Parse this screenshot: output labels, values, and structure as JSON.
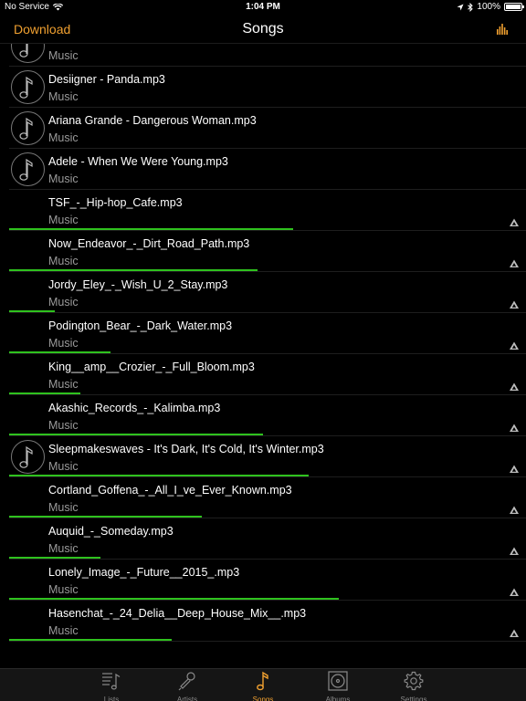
{
  "status": {
    "carrier": "No Service",
    "time": "1:04 PM",
    "battery": "100%"
  },
  "nav": {
    "back_label": "Download",
    "title": "Songs"
  },
  "colors": {
    "accent": "#f0a030",
    "progress": "#2fc21e"
  },
  "songs": [
    {
      "title": "",
      "subtitle": "Music",
      "art": true,
      "cloud": false,
      "progress": 0
    },
    {
      "title": "Desiigner - Panda.mp3",
      "subtitle": "Music",
      "art": true,
      "cloud": false,
      "progress": 0
    },
    {
      "title": "Ariana Grande - Dangerous Woman.mp3",
      "subtitle": "Music",
      "art": true,
      "cloud": false,
      "progress": 0
    },
    {
      "title": "Adele - When We Were Young.mp3",
      "subtitle": "Music",
      "art": true,
      "cloud": false,
      "progress": 0
    },
    {
      "title": "TSF_-_Hip-hop_Cafe.mp3",
      "subtitle": "Music",
      "art": false,
      "cloud": true,
      "progress": 0.56
    },
    {
      "title": "Now_Endeavor_-_Dirt_Road_Path.mp3",
      "subtitle": "Music",
      "art": false,
      "cloud": true,
      "progress": 0.49
    },
    {
      "title": "Jordy_Eley_-_Wish_U_2_Stay.mp3",
      "subtitle": "Music",
      "art": false,
      "cloud": true,
      "progress": 0.09
    },
    {
      "title": "Podington_Bear_-_Dark_Water.mp3",
      "subtitle": "Music",
      "art": false,
      "cloud": true,
      "progress": 0.2
    },
    {
      "title": "King__amp__Crozier_-_Full_Bloom.mp3",
      "subtitle": "Music",
      "art": false,
      "cloud": true,
      "progress": 0.14
    },
    {
      "title": "Akashic_Records_-_Kalimba.mp3",
      "subtitle": "Music",
      "art": false,
      "cloud": true,
      "progress": 0.5
    },
    {
      "title": "Sleepmakeswaves - It's Dark, It's Cold, It's Winter.mp3",
      "subtitle": "Music",
      "art": true,
      "cloud": true,
      "progress": 0.59
    },
    {
      "title": "Cortland_Goffena_-_All_I_ve_Ever_Known.mp3",
      "subtitle": "Music",
      "art": false,
      "cloud": true,
      "progress": 0.38
    },
    {
      "title": "Auquid_-_Someday.mp3",
      "subtitle": "Music",
      "art": false,
      "cloud": true,
      "progress": 0.18
    },
    {
      "title": "Lonely_Image_-_Future__2015_.mp3",
      "subtitle": "Music",
      "art": false,
      "cloud": true,
      "progress": 0.65
    },
    {
      "title": "Hasenchat_-_24_Delia__Deep_House_Mix__.mp3",
      "subtitle": "Music",
      "art": false,
      "cloud": true,
      "progress": 0.32
    }
  ],
  "tabs": [
    {
      "id": "lists",
      "label": "Lists",
      "icon": "lists-icon",
      "active": false
    },
    {
      "id": "artists",
      "label": "Artists",
      "icon": "microphone-icon",
      "active": false
    },
    {
      "id": "songs",
      "label": "Songs",
      "icon": "music-note-icon",
      "active": true
    },
    {
      "id": "albums",
      "label": "Albums",
      "icon": "album-icon",
      "active": false
    },
    {
      "id": "settings",
      "label": "Settings",
      "icon": "gear-icon",
      "active": false
    }
  ]
}
